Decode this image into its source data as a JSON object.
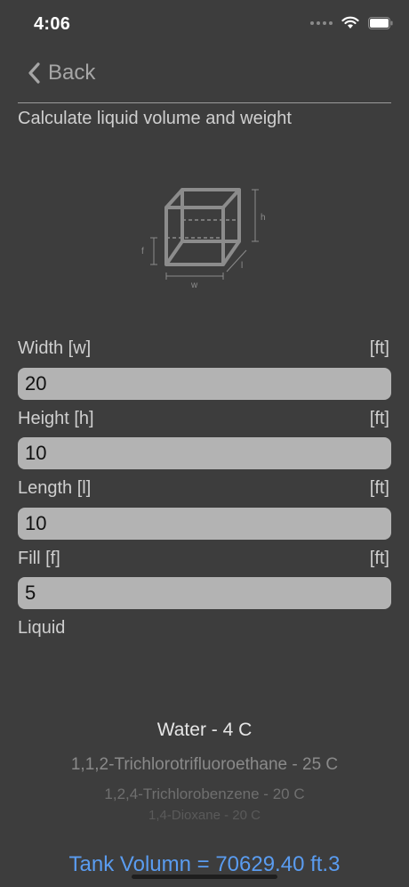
{
  "status_bar": {
    "time": "4:06"
  },
  "nav": {
    "back_label": "Back"
  },
  "page": {
    "title": "Calculate liquid volume and weight"
  },
  "diagram": {
    "labels": {
      "w": "w",
      "h": "h",
      "l": "l",
      "f": "f"
    }
  },
  "fields": [
    {
      "label": "Width [w]",
      "unit": "[ft]",
      "value": "20"
    },
    {
      "label": "Height [h]",
      "unit": "[ft]",
      "value": "10"
    },
    {
      "label": "Length [l]",
      "unit": "[ft]",
      "value": "10"
    },
    {
      "label": "Fill [f]",
      "unit": "[ft]",
      "value": "5"
    }
  ],
  "liquid": {
    "label": "Liquid",
    "options": [
      "Water - 4 C",
      "1,1,2-Trichlorotrifluoroethane - 25 C",
      "1,2,4-Trichlorobenzene - 20 C",
      "1,4-Dioxane - 20 C"
    ]
  },
  "result": {
    "text": "Tank Volumn = 70629.40 ft.3"
  },
  "colors": {
    "background": "#3d3d3d",
    "input_fill": "#b3b3b3",
    "result_accent": "#5a9cf0"
  }
}
